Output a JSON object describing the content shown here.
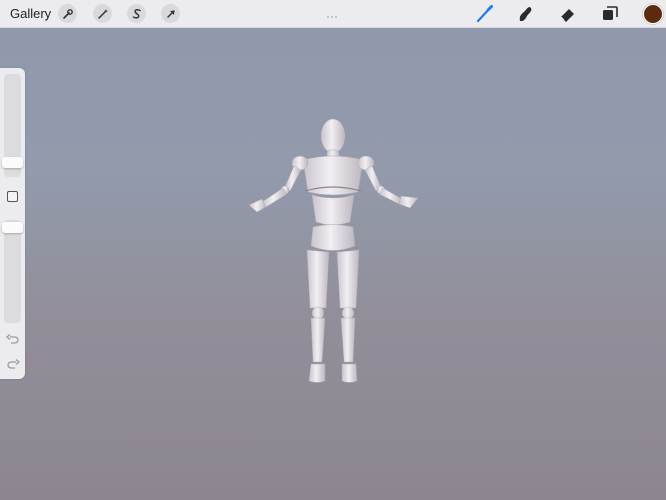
{
  "topbar": {
    "gallery_label": "Gallery",
    "left_tools": [
      {
        "icon": "wrench-icon",
        "name": "actions"
      },
      {
        "icon": "magic-wand-icon",
        "name": "adjustments"
      },
      {
        "icon": "selection-s-icon",
        "name": "selection"
      },
      {
        "icon": "arrow-cursor-icon",
        "name": "transform"
      }
    ],
    "right_tools": [
      {
        "icon": "brush-icon",
        "name": "paint",
        "color": "#1a7cf2"
      },
      {
        "icon": "smudge-icon",
        "name": "smudge"
      },
      {
        "icon": "eraser-icon",
        "name": "eraser"
      },
      {
        "icon": "layers-icon",
        "name": "layers"
      }
    ],
    "current_color": "#5c2a0f"
  },
  "sidebar": {
    "brush_size_level": 0.72,
    "opacity_level": 0.98,
    "modify_icon": "square-icon",
    "undo_icon": "undo-arrow-icon",
    "redo_icon": "redo-arrow-icon"
  },
  "canvas": {
    "background_top": "#8f99ad",
    "background_bottom": "#8d8690",
    "subject": "3d-mannequin-figure"
  }
}
